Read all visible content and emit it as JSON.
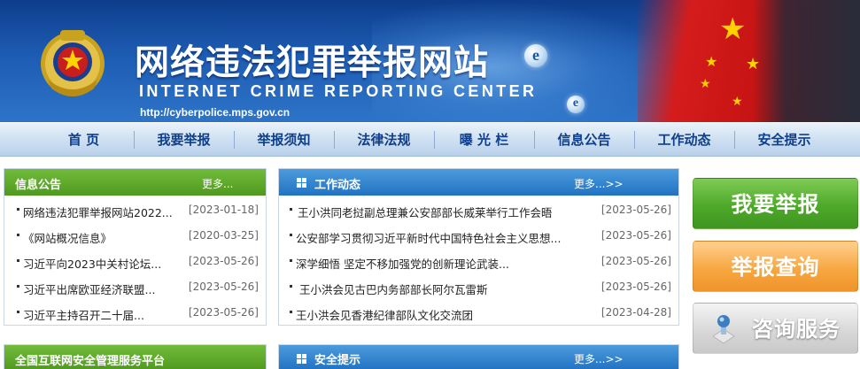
{
  "header": {
    "title_cn": "网络违法犯罪举报网站",
    "title_en": "INTERNET CRIME REPORTING CENTER",
    "url": "http://cyberpolice.mps.gov.cn",
    "e_glyph": "e"
  },
  "nav": {
    "items": [
      "首  页",
      "我要举报",
      "举报须知",
      "法律法规",
      "曝 光 栏",
      "信息公告",
      "工作动态",
      "安全提示"
    ]
  },
  "info_panel": {
    "title": "信息公告",
    "more": "更多...",
    "items": [
      {
        "text": "网络违法犯罪举报网站2022...",
        "date": "[2023-01-18]"
      },
      {
        "text": "《网站概况信息》",
        "date": "[2020-03-25]"
      },
      {
        "text": "习近平向2023中关村论坛...",
        "date": "[2023-05-26]"
      },
      {
        "text": "习近平出席欧亚经济联盟...",
        "date": "[2023-05-26]"
      },
      {
        "text": "习近平主持召开二十届...",
        "date": "[2023-05-26]"
      }
    ]
  },
  "platform_panel": {
    "title": "全国互联网安全管理服务平台"
  },
  "work_panel": {
    "title": "工作动态",
    "more": "更多...>>",
    "items": [
      {
        "text": "王小洪同老挝副总理兼公安部部长威莱举行工作会晤",
        "date": "[2023-05-26]"
      },
      {
        "text": "公安部学习贯彻习近平新时代中国特色社会主义思想...",
        "date": "[2023-05-26]"
      },
      {
        "text": "深学细悟 坚定不移加强党的创新理论武装...",
        "date": "[2023-05-26]"
      },
      {
        "text": "王小洪会见古巴内务部部长阿尔瓦雷斯",
        "date": "[2023-05-26]"
      },
      {
        "text": "王小洪会见香港纪律部队文化交流团",
        "date": "[2023-04-28]"
      }
    ]
  },
  "safety_panel": {
    "title": "安全提示",
    "more": "更多...>>"
  },
  "actions": {
    "report": "我要举报",
    "query": "举报查询",
    "consult": "咨询服务"
  },
  "colors": {
    "header_blue": "#1d5cb3",
    "nav_text": "#0f3f8a",
    "panel_green": "#4f9a1f",
    "panel_blue": "#2173c3",
    "btn_green": "#4ea92a",
    "btn_orange": "#f7a842",
    "btn_grey": "#d8d8d8"
  },
  "icons": [
    "police-emblem-icon",
    "e-globe-icon",
    "star-icon",
    "grid-icon",
    "consult-icon"
  ]
}
